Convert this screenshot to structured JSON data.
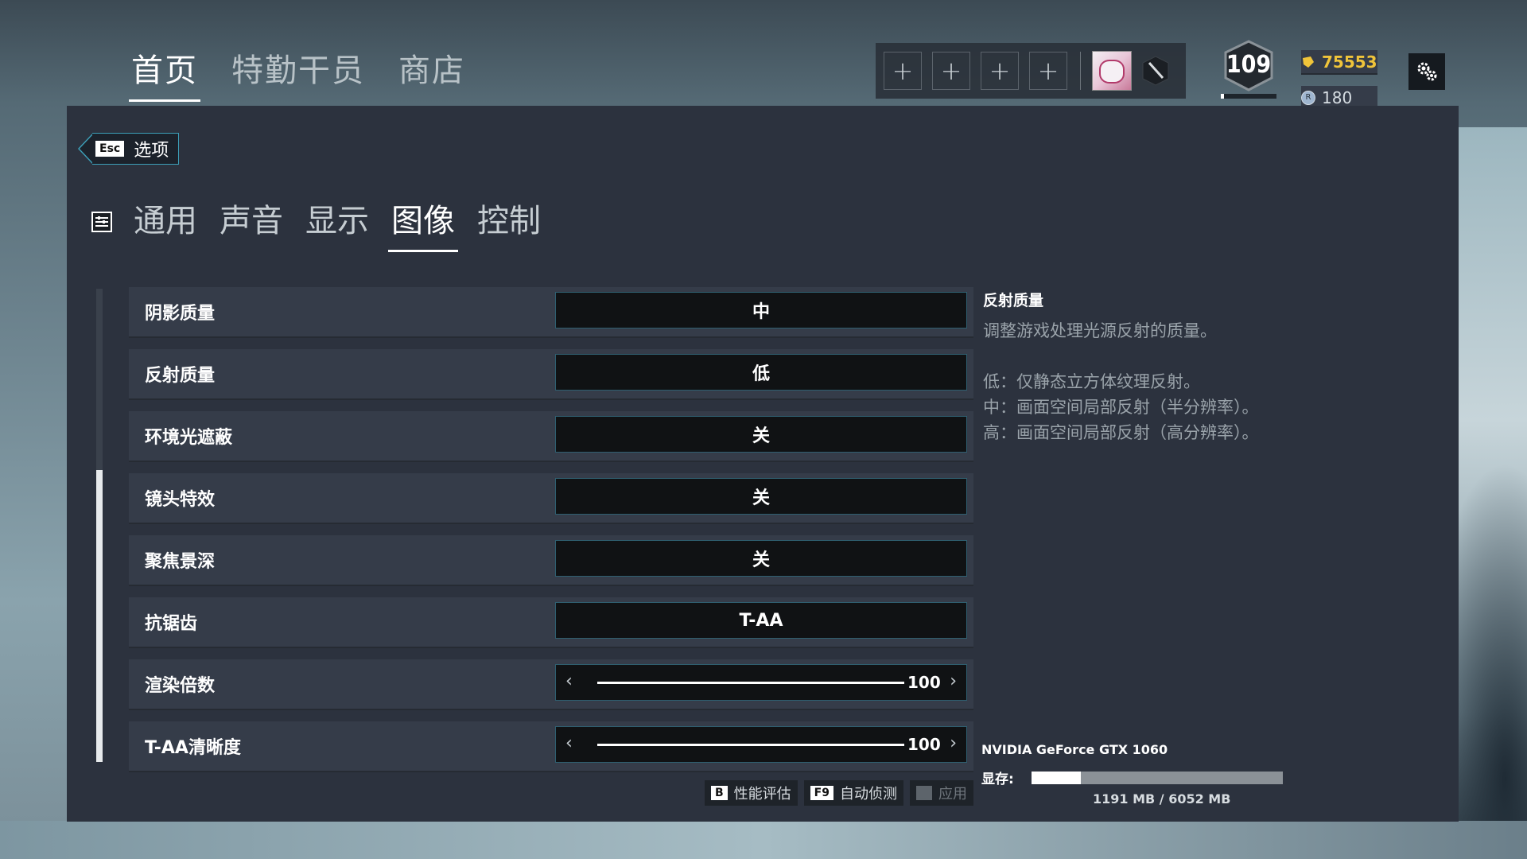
{
  "topnav": {
    "items": [
      "首页",
      "特勤干员",
      "商店"
    ],
    "active_index": 0
  },
  "squad": {
    "slot_symbol": "+"
  },
  "player": {
    "level": "109",
    "level_progress": 0.05
  },
  "currency": {
    "renown": "75553",
    "r6_credits": "180",
    "renown_color": "#f0c43a"
  },
  "options": {
    "esc_key": "Esc",
    "esc_label": "选项"
  },
  "tabs": [
    "通用",
    "声音",
    "显示",
    "图像",
    "控制"
  ],
  "active_tab_index": 3,
  "settings": [
    {
      "label": "阴影质量",
      "value": "中"
    },
    {
      "label": "反射质量",
      "value": "低"
    },
    {
      "label": "环境光遮蔽",
      "value": "关"
    },
    {
      "label": "镜头特效",
      "value": "关"
    },
    {
      "label": "聚焦景深",
      "value": "关"
    },
    {
      "label": "抗锯齿",
      "value": "T-AA"
    },
    {
      "label": "渲染倍数",
      "value": "100",
      "slider_fraction": 1.0
    },
    {
      "label": "T-AA清晰度",
      "value": "100",
      "slider_fraction": 1.0
    }
  ],
  "description": {
    "title": "反射质量",
    "body": "调整游戏处理光源反射的质量。",
    "lines": [
      "低：仅静态立方体纹理反射。",
      "中：画面空间局部反射（半分辨率）。",
      "高：画面空间局部反射（高分辨率）。"
    ]
  },
  "gpu": {
    "name": "NVIDIA GeForce GTX 1060",
    "vram_label": "显存:",
    "vram_text": "1191 MB / 6052 MB",
    "vram_fraction": 0.197
  },
  "actions": [
    {
      "key": "B",
      "label": "性能评估"
    },
    {
      "key": "F9",
      "label": "自动侦测"
    },
    {
      "key": "",
      "label": "应用"
    }
  ],
  "colors": {
    "accent": "#3c9fb8",
    "panel": "#2c323e"
  }
}
